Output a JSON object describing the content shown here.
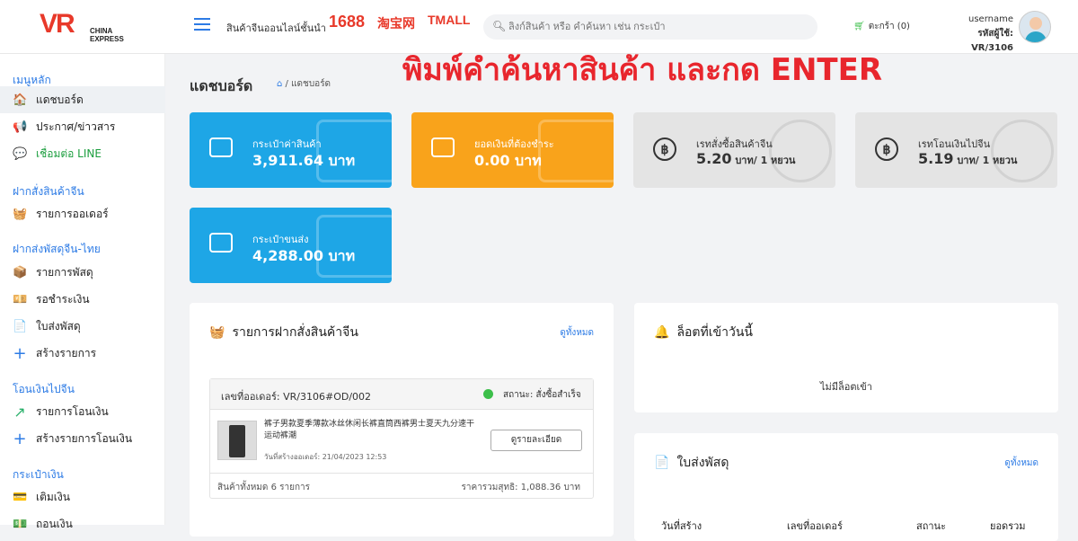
{
  "header": {
    "logo_text": "VR",
    "logo_sub_1": "CHINA",
    "logo_sub_2": "EXPRESS",
    "tagline": "สินค้าจีนออนไลน์ชั้นนำ",
    "brand_1688": "1688",
    "brand_taobao": "淘宝网",
    "brand_tmall": "TMALL",
    "search_placeholder": "ลิงก์สินค้า หรือ คำค้นหา เช่น กระเป๋า",
    "cart_label": "ตะกร้า (0)",
    "username": "username",
    "user_code": "รหัสผู้ใช้: VR/3106"
  },
  "overlay_text": "พิมพ์คำค้นหาสินค้า และกด ENTER",
  "sidebar": {
    "sections": [
      {
        "title": "เมนูหลัก",
        "items": [
          {
            "label": "แดชบอร์ด",
            "icon": "home-icon",
            "glyph": "🏠"
          },
          {
            "label": "ประกาศ/ข่าวสาร",
            "icon": "megaphone-icon",
            "glyph": "📢"
          },
          {
            "label": "เชื่อมต่อ LINE",
            "icon": "line-icon",
            "glyph": "💬"
          }
        ]
      },
      {
        "title": "ฝากสั่งสินค้าจีน",
        "items": [
          {
            "label": "รายการออเดอร์",
            "icon": "basket-icon",
            "glyph": "🧺"
          }
        ]
      },
      {
        "title": "ฝากส่งพัสดุจีน-ไทย",
        "items": [
          {
            "label": "รายการพัสดุ",
            "icon": "box-icon",
            "glyph": "📦"
          },
          {
            "label": "รอชำระเงิน",
            "icon": "cash-icon",
            "glyph": "💴"
          },
          {
            "label": "ใบส่งพัสดุ",
            "icon": "document-icon",
            "glyph": "📄"
          },
          {
            "label": "สร้างรายการ",
            "icon": "plus-icon",
            "glyph": "+"
          }
        ]
      },
      {
        "title": "โอนเงินไปจีน",
        "items": [
          {
            "label": "รายการโอนเงิน",
            "icon": "transfer-arrow-icon",
            "glyph": "↗"
          },
          {
            "label": "สร้างรายการโอนเงิน",
            "icon": "plus-icon",
            "glyph": "+"
          }
        ]
      },
      {
        "title": "กระเป๋าเงิน",
        "items": [
          {
            "label": "เติมเงิน",
            "icon": "wallet-topup-icon",
            "glyph": "💳"
          },
          {
            "label": "ถอนเงิน",
            "icon": "withdraw-icon",
            "glyph": "💵"
          }
        ]
      }
    ]
  },
  "page": {
    "title": "แดชบอร์ด",
    "breadcrumb_home": "⌂",
    "breadcrumb_sep": "/",
    "breadcrumb_current": "แดชบอร์ด"
  },
  "cards": [
    {
      "label": "กระเป๋าค่าสินค้า",
      "value": "3,911.64 บาท",
      "unit": "",
      "color": "#1ea6e6",
      "icon": "wallet-icon"
    },
    {
      "label": "ยอดเงินที่ต้องชำระ",
      "value": "0.00 บาท",
      "unit": "",
      "color": "#f9a31b",
      "icon": "credit-card-icon"
    },
    {
      "label": "เรทสั่งซื้อสินค้าจีน",
      "value": "5.20",
      "unit": " บาท/ 1 หยวน",
      "color": "#e4e4e4",
      "icon": "baht-coin-icon"
    },
    {
      "label": "เรทโอนเงินไปจีน",
      "value": "5.19",
      "unit": " บาท/ 1 หยวน",
      "color": "#e4e4e4",
      "icon": "baht-coin-icon"
    },
    {
      "label": "กระเป๋าขนส่ง",
      "value": "4,288.00 บาท",
      "unit": "",
      "color": "#1ea6e6",
      "icon": "wallet-icon"
    }
  ],
  "orders_panel": {
    "title": "รายการฝากสั่งสินค้าจีน",
    "more": "ดูทั้งหมด",
    "order_no": "เลขที่ออเดอร์: VR/3106#OD/002",
    "status": "สถานะ: สั่งซื้อสำเร็จ",
    "product_name": "裤子男款夏季薄款冰丝休闲长裤直筒西裤男士夏天九分速干运动裤潮",
    "created": "วันที่สร้างออเดอร์: 21/04/2023 12:53",
    "detail_button": "ดูรายละเอียด",
    "item_count": "สินค้าทั้งหมด 6 รายการ",
    "total": "ราคารวมสุทธิ: 1,088.36 บาท"
  },
  "login_panel": {
    "title": "ล็อตที่เข้าวันนี้",
    "empty": "ไม่มีล็อตเข้า"
  },
  "shipping_panel": {
    "title": "ใบส่งพัสดุ",
    "more": "ดูทั้งหมด",
    "columns": [
      "วันที่สร้าง",
      "เลขที่ออเดอร์",
      "สถานะ",
      "ยอดรวม"
    ]
  }
}
